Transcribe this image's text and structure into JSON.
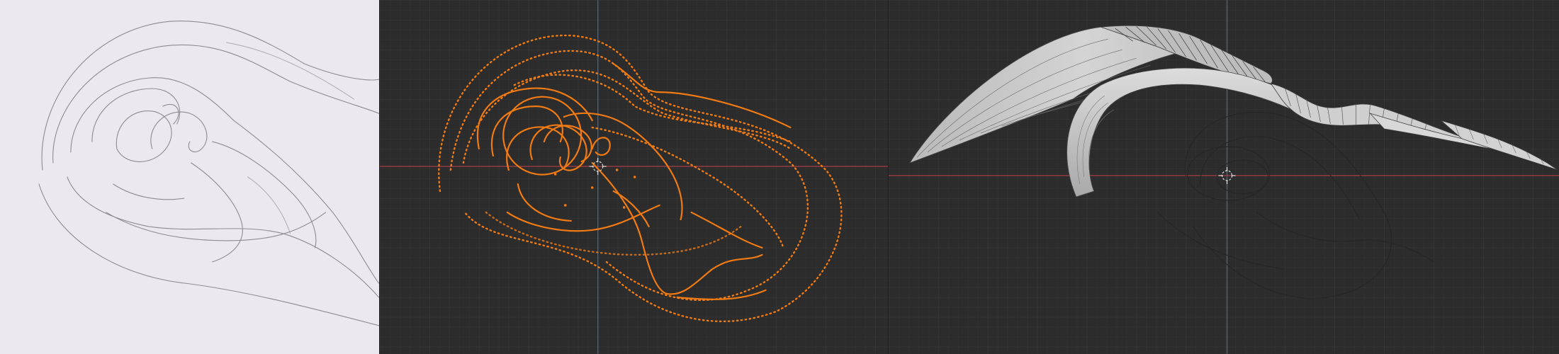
{
  "panels": [
    {
      "id": "sketch",
      "kind": "paper-sketch",
      "background": "#ebe9ef",
      "stroke": "#8c8a90"
    },
    {
      "id": "curves",
      "kind": "viewport-edit-curves",
      "background": "#2c2c2c",
      "grid": true,
      "curve_color": "#f07a14",
      "axis_x_color": "#a8404a",
      "axis_y_color": "#3f6d9e"
    },
    {
      "id": "mesh",
      "kind": "viewport-lofted-surface",
      "background": "#2c2c2c",
      "grid": true,
      "surface_color": "#c9c9c9",
      "wire_color": "#3a3a3a",
      "axis_x_color": "#a8404a",
      "axis_y_color": "#3f6d9e"
    }
  ],
  "icons": [
    "3d-cursor-icon"
  ]
}
